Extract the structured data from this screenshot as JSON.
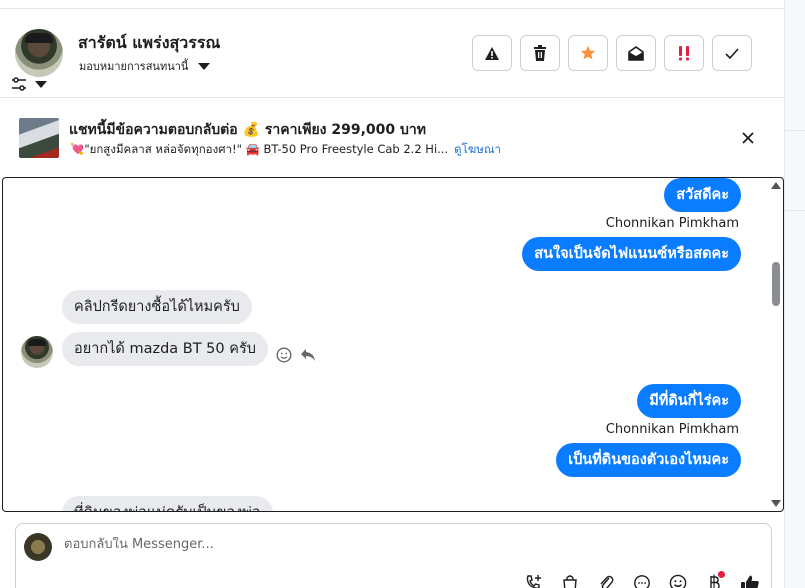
{
  "header": {
    "contact_name": "สารัตน์ แพร่งสุวรรณ",
    "assign_label": "มอบหมายการสนทนานี้",
    "toolbar_icons": [
      "warning-icon",
      "trash-icon",
      "star-icon",
      "envelope-open-icon",
      "priority-icon",
      "check-icon"
    ]
  },
  "ad": {
    "title": "แชทนี้มีข้อความตอบกลับต่อ 💰 ราคาเพียง 299,000 บาท",
    "subtitle": "💘\"ยกสูงมีคลาส หล่อจัดทุกองศา!\" 🚘 BT-50 Pro Freestyle Cab 2.2 Hi...",
    "link_label": "ดูโฆษณา"
  },
  "messages": [
    {
      "direction": "out",
      "text": "สวัสดีคะ"
    },
    {
      "direction": "meta",
      "text": "Chonnikan Pimkham"
    },
    {
      "direction": "out",
      "text": "สนใจเป็นจัดไฟแนนซ์หรือสดคะ"
    },
    {
      "direction": "in",
      "text": "คลิปกรีดยางซื้อได้ไหมครับ"
    },
    {
      "direction": "in",
      "text": "อยากได้ mazda BT 50 ครับ"
    },
    {
      "direction": "out",
      "text": "มีที่ดินกี่ไร่คะ"
    },
    {
      "direction": "meta",
      "text": "Chonnikan Pimkham"
    },
    {
      "direction": "out",
      "text": "เป็นที่ดินของตัวเองไหมคะ"
    },
    {
      "direction": "in",
      "text": "ที่ดินของพ่อแม่ครับเป็นของพ่อ"
    }
  ],
  "composer": {
    "placeholder": "ตอบกลับใน Messenger..."
  },
  "colors": {
    "outgoing_bubble": "#0a7cff",
    "incoming_bubble": "#e9eaed",
    "star": "#f7923a",
    "priority": "#e41e3f",
    "link": "#216fdb"
  }
}
